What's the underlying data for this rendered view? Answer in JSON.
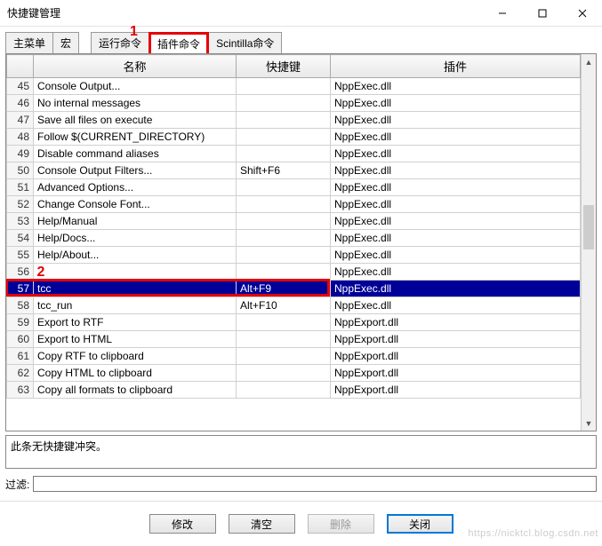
{
  "window": {
    "title": "快捷键管理"
  },
  "annotations": {
    "tab": "1",
    "row": "2"
  },
  "tabs": [
    {
      "label": "主菜单"
    },
    {
      "label": "宏"
    },
    {
      "label": "运行命令"
    },
    {
      "label": "插件命令"
    },
    {
      "label": "Scintilla命令"
    }
  ],
  "columns": {
    "rownum": "",
    "name": "名称",
    "shortcut": "快捷键",
    "plugin": "插件"
  },
  "rows": [
    {
      "n": "45",
      "name": "Console Output...",
      "shortcut": "",
      "plugin": "NppExec.dll"
    },
    {
      "n": "46",
      "name": "No internal messages",
      "shortcut": "",
      "plugin": "NppExec.dll"
    },
    {
      "n": "47",
      "name": "Save all files on execute",
      "shortcut": "",
      "plugin": "NppExec.dll"
    },
    {
      "n": "48",
      "name": "Follow $(CURRENT_DIRECTORY)",
      "shortcut": "",
      "plugin": "NppExec.dll"
    },
    {
      "n": "49",
      "name": "Disable command aliases",
      "shortcut": "",
      "plugin": "NppExec.dll"
    },
    {
      "n": "50",
      "name": "Console Output Filters...",
      "shortcut": "Shift+F6",
      "plugin": "NppExec.dll"
    },
    {
      "n": "51",
      "name": "Advanced Options...",
      "shortcut": "",
      "plugin": "NppExec.dll"
    },
    {
      "n": "52",
      "name": "Change Console Font...",
      "shortcut": "",
      "plugin": "NppExec.dll"
    },
    {
      "n": "53",
      "name": "Help/Manual",
      "shortcut": "",
      "plugin": "NppExec.dll"
    },
    {
      "n": "54",
      "name": "Help/Docs...",
      "shortcut": "",
      "plugin": "NppExec.dll"
    },
    {
      "n": "55",
      "name": "Help/About...",
      "shortcut": "",
      "plugin": "NppExec.dll"
    },
    {
      "n": "56",
      "name": "",
      "shortcut": "",
      "plugin": "NppExec.dll"
    },
    {
      "n": "57",
      "name": "tcc",
      "shortcut": "Alt+F9",
      "plugin": "NppExec.dll",
      "selected": true
    },
    {
      "n": "58",
      "name": "tcc_run",
      "shortcut": "Alt+F10",
      "plugin": "NppExec.dll"
    },
    {
      "n": "59",
      "name": "Export to RTF",
      "shortcut": "",
      "plugin": "NppExport.dll"
    },
    {
      "n": "60",
      "name": "Export to HTML",
      "shortcut": "",
      "plugin": "NppExport.dll"
    },
    {
      "n": "61",
      "name": "Copy RTF to clipboard",
      "shortcut": "",
      "plugin": "NppExport.dll"
    },
    {
      "n": "62",
      "name": "Copy HTML to clipboard",
      "shortcut": "",
      "plugin": "NppExport.dll"
    },
    {
      "n": "63",
      "name": "Copy all formats to clipboard",
      "shortcut": "",
      "plugin": "NppExport.dll"
    }
  ],
  "conflict_text": "此条无快捷键冲突。",
  "filter": {
    "label": "过滤:",
    "value": ""
  },
  "buttons": {
    "modify": "修改",
    "clear": "清空",
    "delete": "删除",
    "close": "关闭"
  },
  "watermark": "https://nicktcl.blog.csdn.net"
}
